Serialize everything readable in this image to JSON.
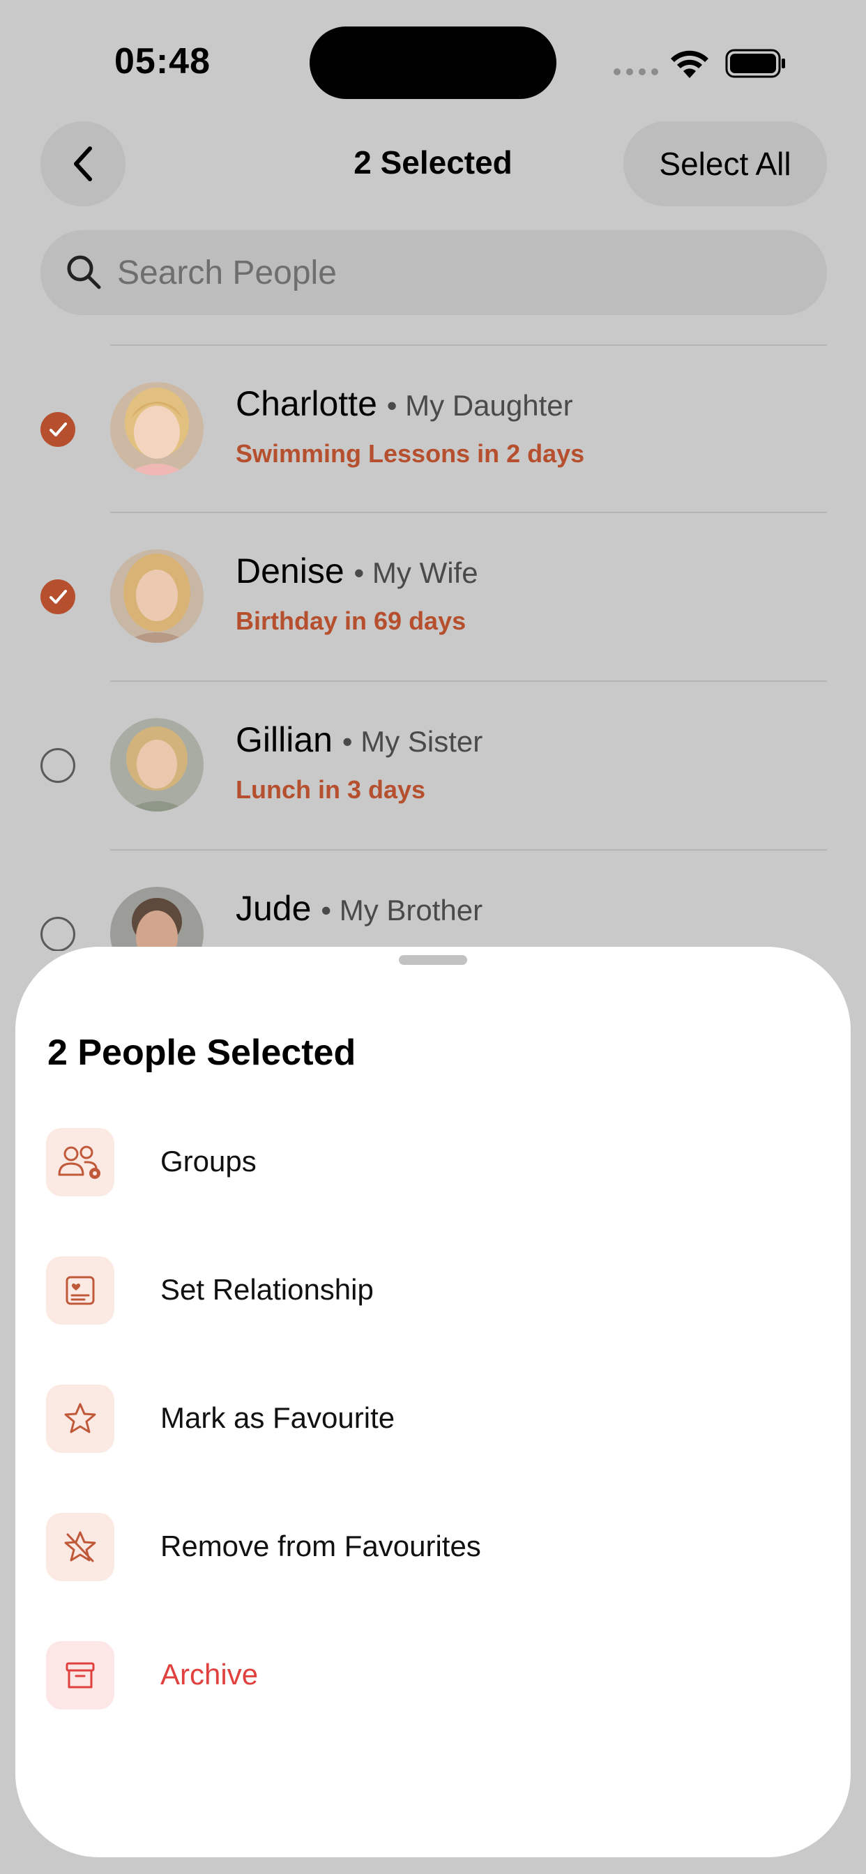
{
  "status_bar": {
    "time": "05:48",
    "icons": [
      "cellular-signal-icon",
      "wifi-icon",
      "battery-icon"
    ]
  },
  "nav": {
    "back_icon": "chevron-left-icon",
    "title": "2 Selected",
    "select_all_label": "Select All"
  },
  "search": {
    "placeholder": "Search People",
    "value": "",
    "icon": "magnifying-glass-icon"
  },
  "people": [
    {
      "name": "Charlotte",
      "relation": "• My Daughter",
      "event": "Swimming Lessons in 2 days",
      "selected": true
    },
    {
      "name": "Denise",
      "relation": "• My Wife",
      "event": "Birthday in 69 days",
      "selected": true
    },
    {
      "name": "Gillian",
      "relation": "• My Sister",
      "event": "Lunch in 3 days",
      "selected": false
    },
    {
      "name": "Jude",
      "relation": "• My Brother",
      "event": "",
      "selected": false
    }
  ],
  "sheet": {
    "title": "2 People Selected",
    "actions": [
      {
        "label": "Groups",
        "icon": "people-gear-icon"
      },
      {
        "label": "Set Relationship",
        "icon": "contact-card-icon"
      },
      {
        "label": "Mark as Favourite",
        "icon": "star-icon"
      },
      {
        "label": "Remove from Favourites",
        "icon": "star-slash-icon"
      },
      {
        "label": "Archive",
        "icon": "archive-box-icon",
        "destructive": true
      }
    ]
  },
  "colors": {
    "accent": "#b64f2e",
    "destructive": "#e0413f",
    "backdrop": "#c9c9c9",
    "sheet": "#ffffff",
    "icon_tile": "#fbeae3"
  }
}
